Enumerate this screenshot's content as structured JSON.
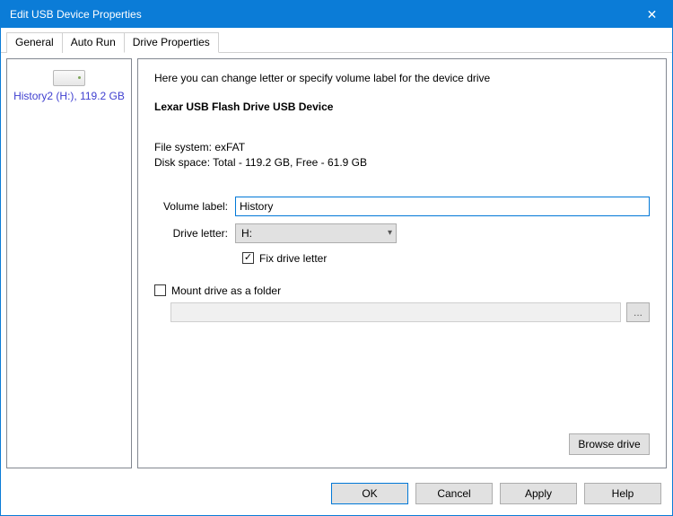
{
  "window": {
    "title": "Edit USB Device Properties"
  },
  "tabs": {
    "general": "General",
    "autorun": "Auto Run",
    "driveprops": "Drive Properties"
  },
  "sidebar": {
    "drive_label": "History2 (H:), 119.2 GB"
  },
  "main": {
    "intro": "Here you can change letter or specify volume label for the device drive",
    "device_name": "Lexar USB Flash Drive USB Device",
    "fs_line": "File system: exFAT",
    "disk_line": "Disk space: Total - 119.2 GB, Free - 61.9 GB",
    "volume_label_lbl": "Volume label:",
    "volume_label_value": "History",
    "drive_letter_lbl": "Drive letter:",
    "drive_letter_value": "H:",
    "fix_drive_letter": "Fix drive letter",
    "mount_label": "Mount drive as a folder",
    "mount_path": "",
    "browse_small": "...",
    "browse_drive": "Browse drive"
  },
  "buttons": {
    "ok": "OK",
    "cancel": "Cancel",
    "apply": "Apply",
    "help": "Help"
  }
}
